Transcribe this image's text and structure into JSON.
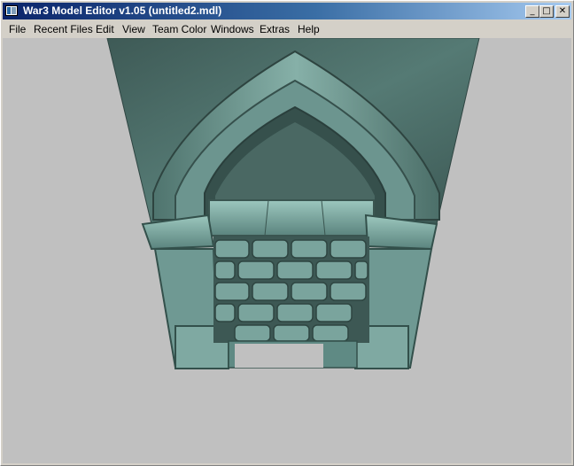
{
  "window": {
    "title": "War3 Model Editor v1.05 (untitled2.mdl)",
    "controls": {
      "minimize": "_",
      "maximize": "□",
      "close": "✕"
    }
  },
  "menu": {
    "items": [
      "File",
      "Recent Files",
      "Edit",
      "View",
      "Team Color",
      "Windows",
      "Extras",
      "Help"
    ]
  },
  "viewport": {
    "background_color": "#c0c0c0",
    "model": "stone fireplace"
  },
  "colors": {
    "title_gradient_start": "#0a246a",
    "title_gradient_end": "#a6caf0",
    "window_face": "#d4d0c8",
    "stone": "#5f8a84"
  }
}
